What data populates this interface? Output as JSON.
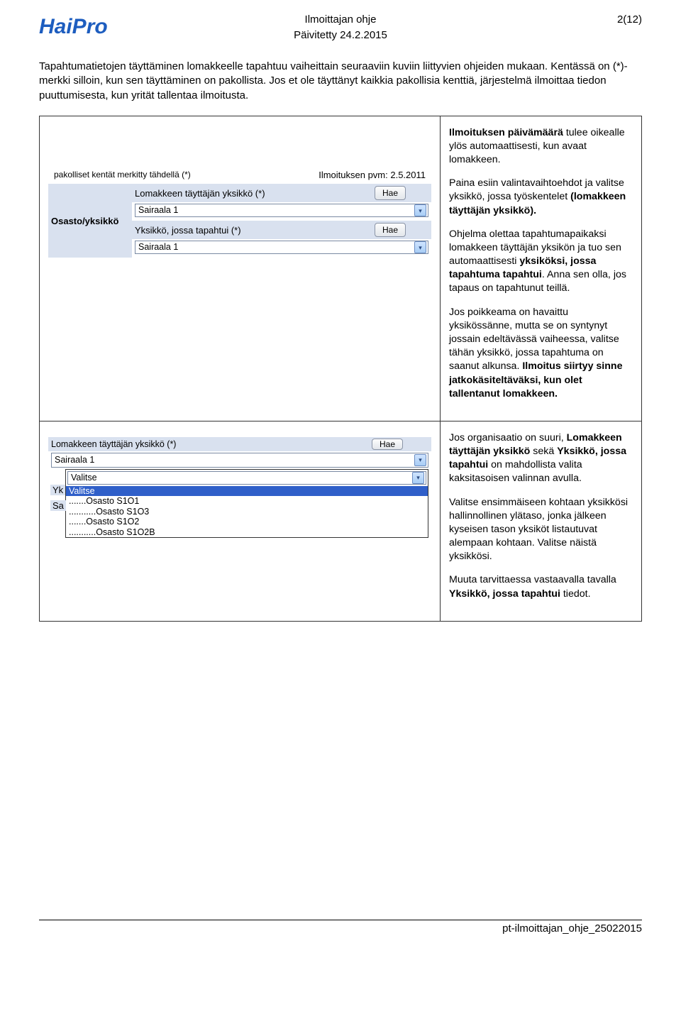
{
  "header": {
    "logo": "HaiPro",
    "title": "Ilmoittajan ohje",
    "updated": "Päivitetty 24.2.2015",
    "page": "2(12)"
  },
  "intro": "Tapahtumatietojen täyttäminen lomakkeelle tapahtuu vaiheittain seuraaviin kuviin liittyvien ohjeiden mukaan. Kentässä on (*)-merkki silloin, kun sen täyttäminen on pakollista. Jos et ole täyttänyt kaikkia pakollisia kenttiä, järjestelmä ilmoittaa tiedon puuttumisesta, kun yrität tallentaa ilmoitusta.",
  "form1": {
    "top_note": "pakolliset kentät merkitty tähdellä (*)",
    "top_date": "Ilmoituksen pvm: 2.5.2011",
    "section_label": "Osasto/yksikkö",
    "row1_label": "Lomakkeen täyttäjän yksikkö (*)",
    "row1_btn": "Hae",
    "row1_value": "Sairaala 1",
    "row2_label": "Yksikkö, jossa tapahtui (*)",
    "row2_btn": "Hae",
    "row2_value": "Sairaala 1"
  },
  "form2": {
    "head_label": "Lomakkeen täyttäjän yksikkö (*)",
    "head_btn": "Hae",
    "dd_value": "Sairaala 1",
    "txt_value": "Valitse",
    "side_yk": "Yk",
    "side_sa": "Sa",
    "opt_sel": "Valitse",
    "opt1": ".......Osasto S1O1",
    "opt2": "...........Osasto S1O3",
    "opt3": ".......Osasto S1O2",
    "opt4": "...........Osasto S1O2B"
  },
  "right1": {
    "p1a": "Ilmoituksen päivämäärä",
    "p1b": " tulee oikealle ylös automaattisesti, kun avaat lomakkeen.",
    "p2a": "Paina esiin valintavaihtoehdot ja valitse yksikkö, jossa työskentelet ",
    "p2b": "(lomakkeen täyttäjän yksikkö).",
    "p3a": "Ohjelma olettaa tapahtumapaikaksi lomakkeen täyttäjän yksikön ja tuo sen automaattisesti ",
    "p3b": "yksiköksi, jossa tapahtuma tapahtui",
    "p3c": ". Anna sen olla, jos tapaus on tapahtunut teillä.",
    "p4a": "Jos poikkeama on havaittu yksikössänne, mutta se on syntynyt jossain edeltävässä vaiheessa, valitse tähän yksikkö, jossa tapahtuma on saanut alkunsa. ",
    "p4b": "Ilmoitus siirtyy sinne jatkokäsiteltäväksi, kun olet tallentanut lomakkeen."
  },
  "right2": {
    "p1a": "Jos organisaatio on suuri, ",
    "p1b": "Lomakkeen täyttäjän yksikkö",
    "p1c": " sekä ",
    "p1d": "Yksikkö, jossa tapahtui",
    "p1e": " on mahdollista valita kaksitasoisen valinnan avulla.",
    "p2": "Valitse ensimmäiseen kohtaan yksikkösi hallinnollinen ylätaso, jonka jälkeen kyseisen tason yksiköt listautuvat alempaan kohtaan. Valitse näistä yksikkösi.",
    "p3a": "Muuta tarvittaessa vastaavalla tavalla ",
    "p3b": "Yksikkö, jossa tapahtui",
    "p3c": " tiedot."
  },
  "footer": "pt-ilmoittajan_ohje_25022015"
}
